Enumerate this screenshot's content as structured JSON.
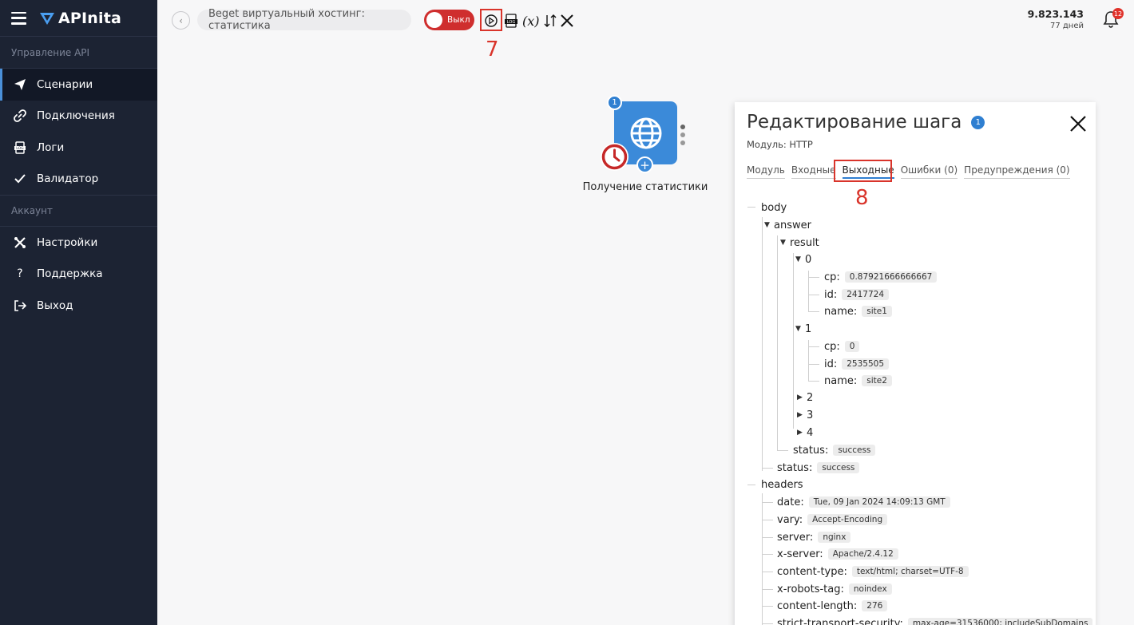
{
  "sidebar": {
    "logo": "APInita",
    "section_api": "Управление API",
    "items_api": [
      {
        "label": "Сценарии",
        "icon": "send-icon"
      },
      {
        "label": "Подключения",
        "icon": "link-icon"
      },
      {
        "label": "Логи",
        "icon": "log-icon"
      },
      {
        "label": "Валидатор",
        "icon": "check-icon"
      }
    ],
    "section_account": "Аккаунт",
    "items_account": [
      {
        "label": "Настройки",
        "icon": "tools-icon"
      },
      {
        "label": "Поддержка",
        "icon": "question-icon"
      },
      {
        "label": "Выход",
        "icon": "logout-icon"
      }
    ]
  },
  "topbar": {
    "scenario_name": "Beget виртуальный хостинг: статистика",
    "toggle_label": "Выкл",
    "annotation_7": "7",
    "balance": "9.823.143",
    "days": "77 дней",
    "notifications": "12"
  },
  "node": {
    "number": "1",
    "label": "Получение статистики"
  },
  "panel": {
    "title": "Редактирование шага",
    "badge": "1",
    "module": "Модуль: HTTP",
    "tabs": [
      "Модуль",
      "Входные",
      "Выходные",
      "Ошибки (0)",
      "Предупреждения (0)"
    ],
    "active_tab": "Выходные",
    "annotation_8": "8"
  },
  "tree": {
    "body": "body",
    "answer": "answer",
    "result": "result",
    "item0": "0",
    "item0_cp_key": "cp:",
    "item0_cp": "0.87921666666667",
    "item0_id_key": "id:",
    "item0_id": "2417724",
    "item0_name_key": "name:",
    "item0_name": "site1",
    "item1": "1",
    "item1_cp_key": "cp:",
    "item1_cp": "0",
    "item1_id_key": "id:",
    "item1_id": "2535505",
    "item1_name_key": "name:",
    "item1_name": "site2",
    "item2": "2",
    "item3": "3",
    "item4": "4",
    "result_status_key": "status:",
    "result_status": "success",
    "answer_status_key": "status:",
    "answer_status": "success",
    "headers": "headers",
    "header_rows": [
      {
        "key": "date:",
        "value": "Tue, 09 Jan 2024 14:09:13 GMT"
      },
      {
        "key": "vary:",
        "value": "Accept-Encoding"
      },
      {
        "key": "server:",
        "value": "nginx"
      },
      {
        "key": "x-server:",
        "value": "Apache/2.4.12"
      },
      {
        "key": "content-type:",
        "value": "text/html; charset=UTF-8"
      },
      {
        "key": "x-robots-tag:",
        "value": "noindex"
      },
      {
        "key": "content-length:",
        "value": "276"
      },
      {
        "key": "strict-transport-security:",
        "value": "max-age=31536000; includeSubDomains"
      }
    ]
  },
  "colors": {
    "sidebar_bg": "#1c2333",
    "accent": "#2f7fd1",
    "node": "#3b8ad9",
    "toggle_off": "#cf2e2e",
    "annotation": "#d9342b"
  }
}
